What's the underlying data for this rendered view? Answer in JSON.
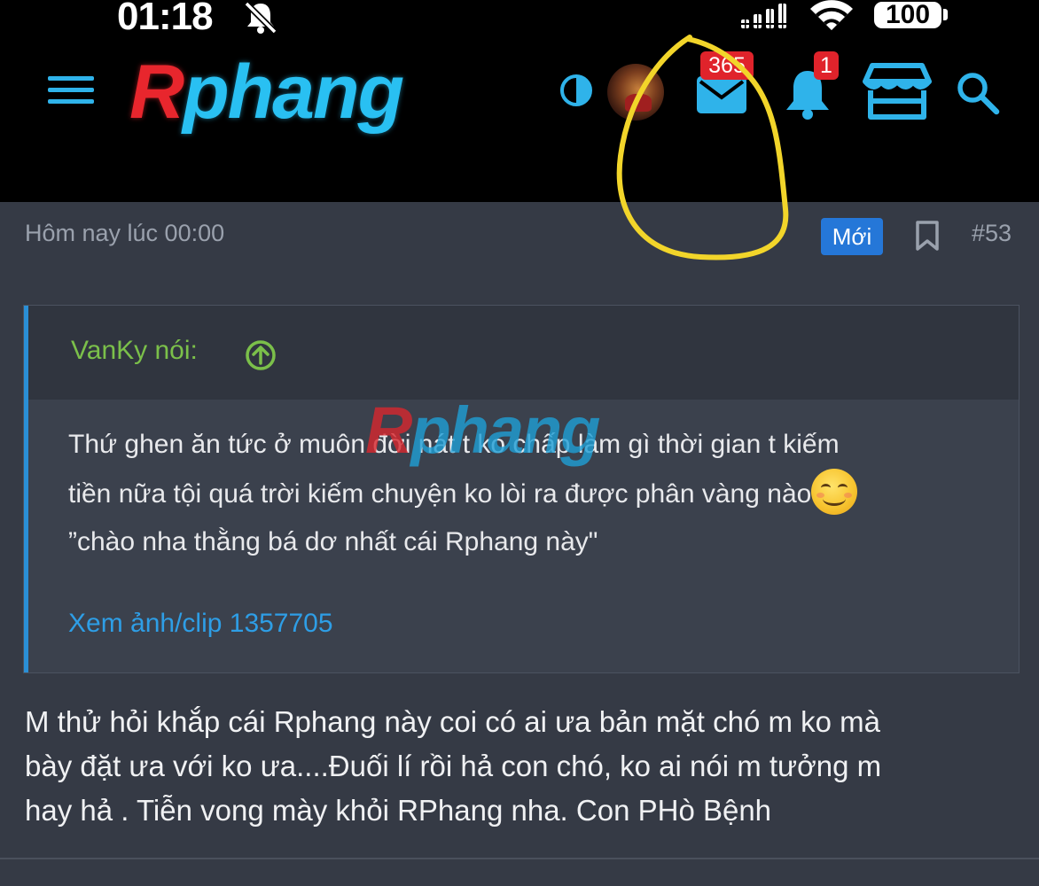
{
  "status_bar": {
    "time": "01:18",
    "battery": "100"
  },
  "header": {
    "logo_first": "R",
    "logo_rest": "phang",
    "mail_badge": "365",
    "notification_badge": "1",
    "accent_color": "#2fb3ea",
    "badge_color": "#e0232b"
  },
  "post": {
    "time": "Hôm nay lúc 00:00",
    "new_label": "Mới",
    "number": "#53",
    "quote": {
      "author": "VanKy nói:",
      "lines": [
        "Thứ ghen ăn tức ở muôn đời nát t ko chấp làm gì thời gian t kiếm",
        "tiền nữa tội quá trời kiếm chuyện ko lòi ra được phân vàng nào",
        "”chào nha thằng bá dơ nhất cái Rphang này\""
      ],
      "media_link": "Xem ảnh/clip 1357705"
    },
    "watermark_first": "R",
    "watermark_rest": "phang",
    "reply_lines": [
      "M thử hỏi khắp cái Rphang này coi có ai ưa bản mặt chó m ko mà",
      "bày đặt ưa với ko ưa....Đuối lí rồi hả con chó, ko ai nói m tưởng m",
      "hay hả . Tiễn vong mày khỏi RPhang nha. Con PHò Bệnh"
    ]
  },
  "colors": {
    "page_bg": "#353a45",
    "quote_bg": "#3b414d",
    "author_green": "#7bc04a",
    "link_blue": "#2e9ee6",
    "new_badge": "#2577d8",
    "annotation_yellow": "#f2d52a"
  }
}
